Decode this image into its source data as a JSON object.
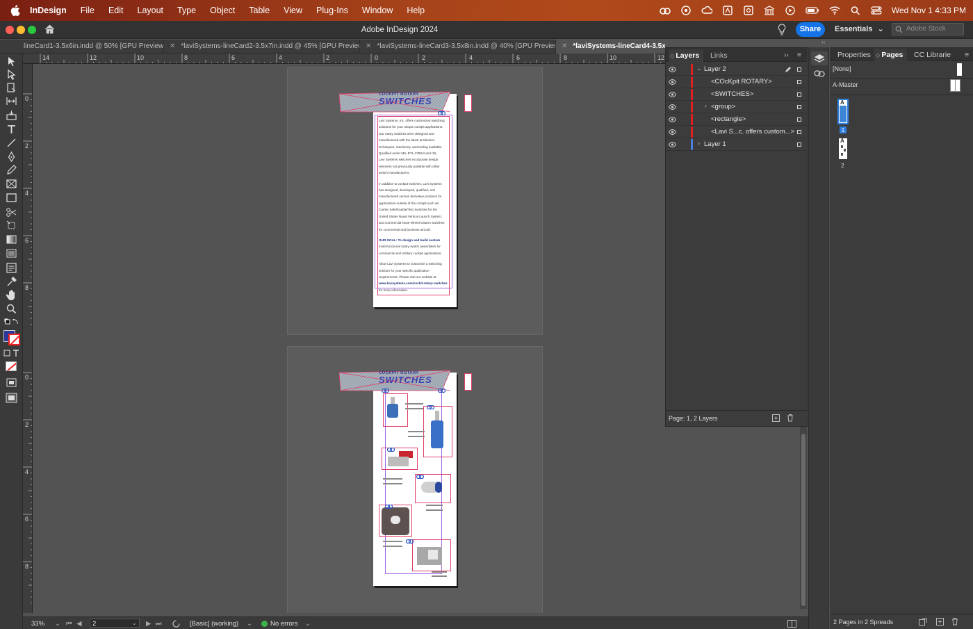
{
  "menubar": {
    "app_name": "InDesign",
    "items": [
      "File",
      "Edit",
      "Layout",
      "Type",
      "Object",
      "Table",
      "View",
      "Plug-Ins",
      "Window",
      "Help"
    ],
    "clock": "Wed Nov 1  4:33 PM"
  },
  "appbar": {
    "title": "Adobe InDesign 2024",
    "share_label": "Share",
    "workspace_label": "Essentials",
    "stock_placeholder": "Adobe Stock"
  },
  "tabs": [
    {
      "label": "lineCard1-3.5x6in.indd @ 50% [GPU Preview]"
    },
    {
      "label": "*laviSystems-lineCard2-3.5x7in.indd @ 45% [GPU Preview]"
    },
    {
      "label": "*laviSystems-lineCard3-3.5x8in.indd @ 40% [GPU Preview]"
    },
    {
      "label": "*laviSystems-lineCard4-3.5x9in."
    }
  ],
  "ruler": {
    "h_labels": [
      "14",
      "12",
      "10",
      "8",
      "6",
      "4",
      "2",
      "0",
      "2",
      "4",
      "6",
      "8",
      "10",
      "12"
    ],
    "v_labels_spread1": [
      "0",
      "2",
      "4",
      "6",
      "8"
    ],
    "v_labels_spread2": [
      "0",
      "2",
      "4",
      "6",
      "8"
    ]
  },
  "card": {
    "heading_small": "COCKPIT ROTARY",
    "heading_large": "SWITCHES",
    "paragraphs": [
      [
        "Lavi Systems, Inc. offers customized switching",
        "solutions for your unique cockpit applications.",
        "Our rotary switches were designed and",
        "manufactured with the latest production",
        "techniques, machinery, and tooling available.",
        "Qualified under MIL-DTL-3786/4 and /15,",
        "Lavi Systems switches incorporate design",
        "elements not previously possible with other",
        "switch manufacturers."
      ],
      [
        "In addition to cockpit switches, Lavi Systems",
        "has designed, developed, qualified, and",
        "manufactured various derivative products for",
        "applications outside of the cockpit such as:",
        "Carrier Safe/Enable/Test Switches for the",
        "United States Naval Vertical Launch System,",
        "and commercial Nose-Wheel Disarm Switches",
        "for commercial and business aircraft."
      ],
      [
        "OUR GOAL: To design and build custom",
        "multi-functional rotary switch assemblies for",
        "commercial and military cockpit applications."
      ],
      [
        "Allow Lavi Systems to customize a switching",
        "solution for your specific application",
        "requirements. Please visit our website at",
        "www.lavisystems.com/cockit-rotary-switches",
        "for more information."
      ]
    ]
  },
  "layers": {
    "tab_layers": "Layers",
    "tab_links": "Links",
    "rows": [
      {
        "name": "Layer 2",
        "color": "#e0201f"
      },
      {
        "name": "<COcKpit ROTARY>",
        "color": "#e0201f"
      },
      {
        "name": "<SWITCHES>",
        "color": "#e0201f"
      },
      {
        "name": "<group>",
        "color": "#e0201f"
      },
      {
        "name": "<rectangle>",
        "color": "#e0201f"
      },
      {
        "name": "<Lavi S...c. offers custom...>",
        "color": "#e0201f"
      },
      {
        "name": "Layer 1",
        "color": "#4a7fe0"
      }
    ],
    "footer": "Page: 1, 2 Layers"
  },
  "pages": {
    "tab_properties": "Properties",
    "tab_pages": "Pages",
    "tab_cc": "CC Librarie",
    "none_label": "[None]",
    "master_label": "A-Master",
    "page1_number": "1",
    "page2_number": "2",
    "page_letter": "A",
    "footer": "2 Pages in 2 Spreads"
  },
  "status": {
    "zoom": "33%",
    "page_field": "2",
    "preflight_profile": "[Basic] (working)",
    "errors": "No errors"
  }
}
